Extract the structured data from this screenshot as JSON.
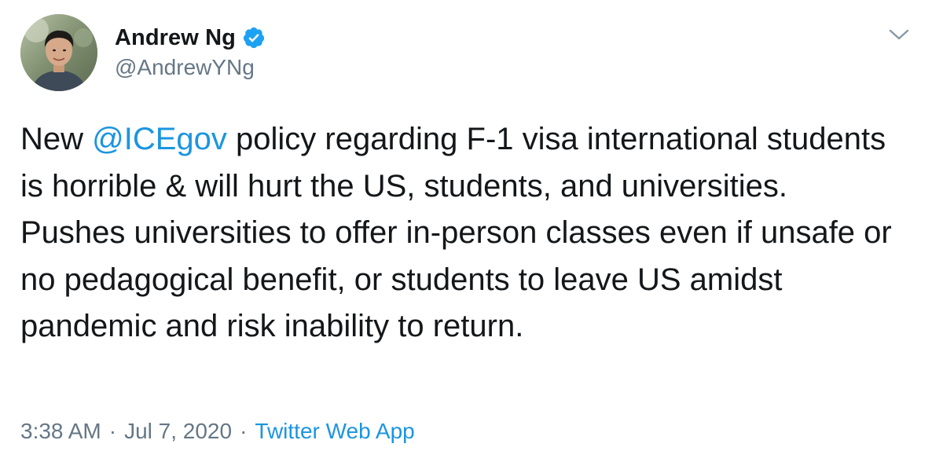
{
  "author": {
    "display_name": "Andrew Ng",
    "handle": "@AndrewYNg",
    "verified": true
  },
  "tweet": {
    "text_before_mention": "New ",
    "mention": "@ICEgov",
    "text_after_mention": " policy regarding F-1 visa international students is horrible & will hurt the US, students, and universities. Pushes universities to offer in-person classes even if unsafe or no pedagogical benefit, or students to leave US amidst pandemic and risk inability to return."
  },
  "meta": {
    "time": "3:38 AM",
    "separator": "·",
    "date": "Jul 7, 2020",
    "source": "Twitter Web App"
  },
  "icons": {
    "verified": "verified-badge-icon",
    "menu": "chevron-down-icon"
  },
  "colors": {
    "link": "#1b95e0",
    "verified": "#1da1f2",
    "secondary_text": "#657786",
    "primary_text": "#14171a"
  }
}
